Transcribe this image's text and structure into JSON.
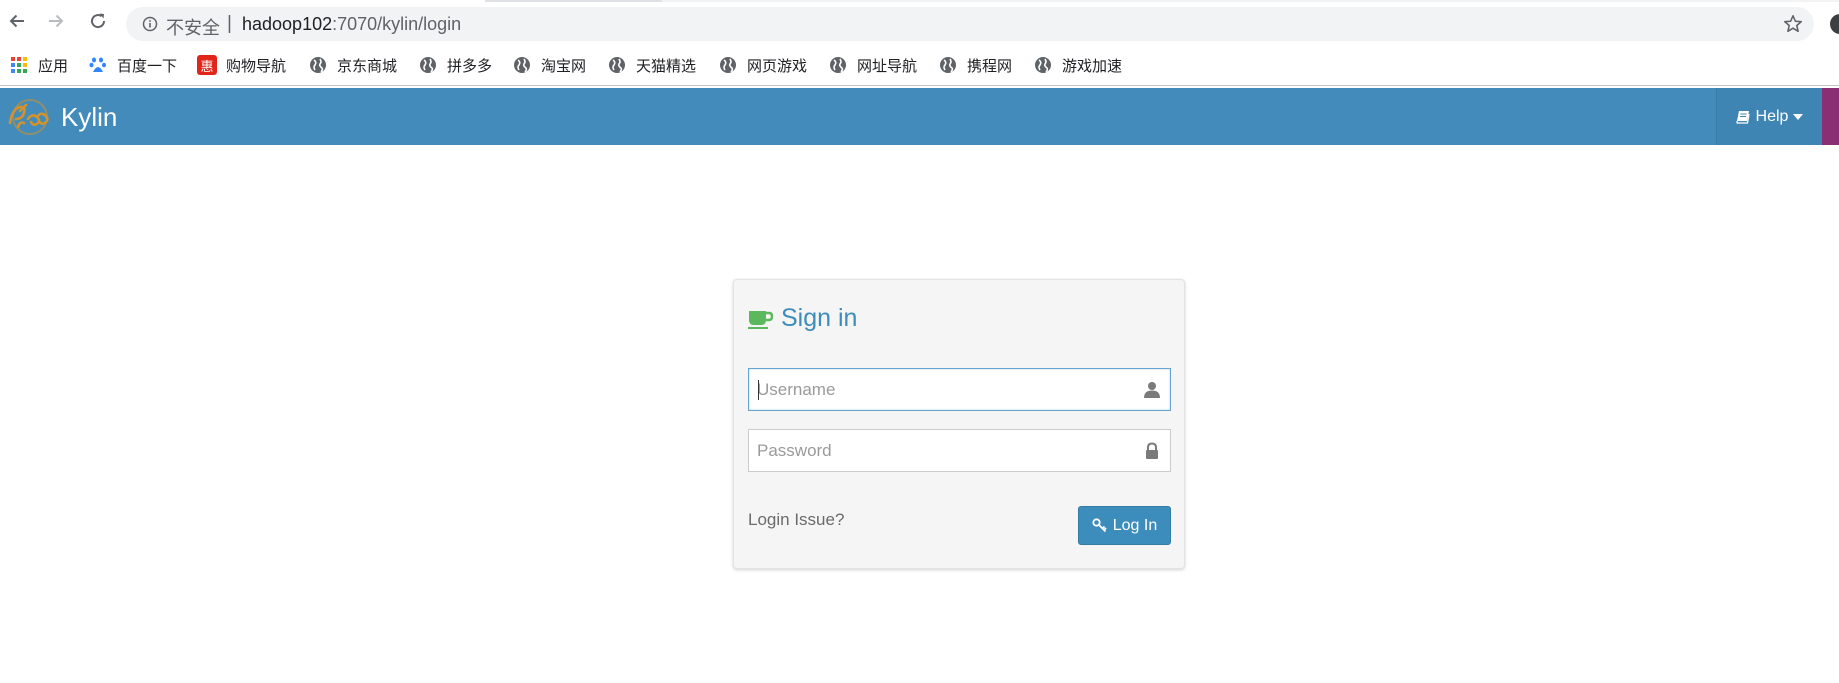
{
  "browser": {
    "security_label": "不安全",
    "separator": "|",
    "url_host": "hadoop102",
    "url_path": ":7070/kylin/login",
    "bookmarks": [
      {
        "label": "应用",
        "icon": "apps-grid-icon"
      },
      {
        "label": "百度一下",
        "icon": "baidu-paw-icon"
      },
      {
        "label": "购物导航",
        "icon": "hui-badge-icon"
      },
      {
        "label": "京东商城",
        "icon": "globe-icon"
      },
      {
        "label": "拼多多",
        "icon": "globe-icon"
      },
      {
        "label": "淘宝网",
        "icon": "globe-icon"
      },
      {
        "label": "天猫精选",
        "icon": "globe-icon"
      },
      {
        "label": "网页游戏",
        "icon": "globe-icon"
      },
      {
        "label": "网址导航",
        "icon": "globe-icon"
      },
      {
        "label": "携程网",
        "icon": "globe-icon"
      },
      {
        "label": "游戏加速",
        "icon": "globe-icon"
      }
    ],
    "hui_badge_text": "惠"
  },
  "navbar": {
    "brand": "Kylin",
    "help_label": "Help",
    "colors": {
      "bar": "#428bba",
      "accent_strip": "#8a2f73"
    }
  },
  "signin": {
    "title": "Sign in",
    "username_placeholder": "Username",
    "password_placeholder": "Password",
    "login_issue": "Login Issue?",
    "login_button": "Log In",
    "colors": {
      "primary": "#3c8dbc",
      "title_icon": "#5cb85c"
    }
  }
}
